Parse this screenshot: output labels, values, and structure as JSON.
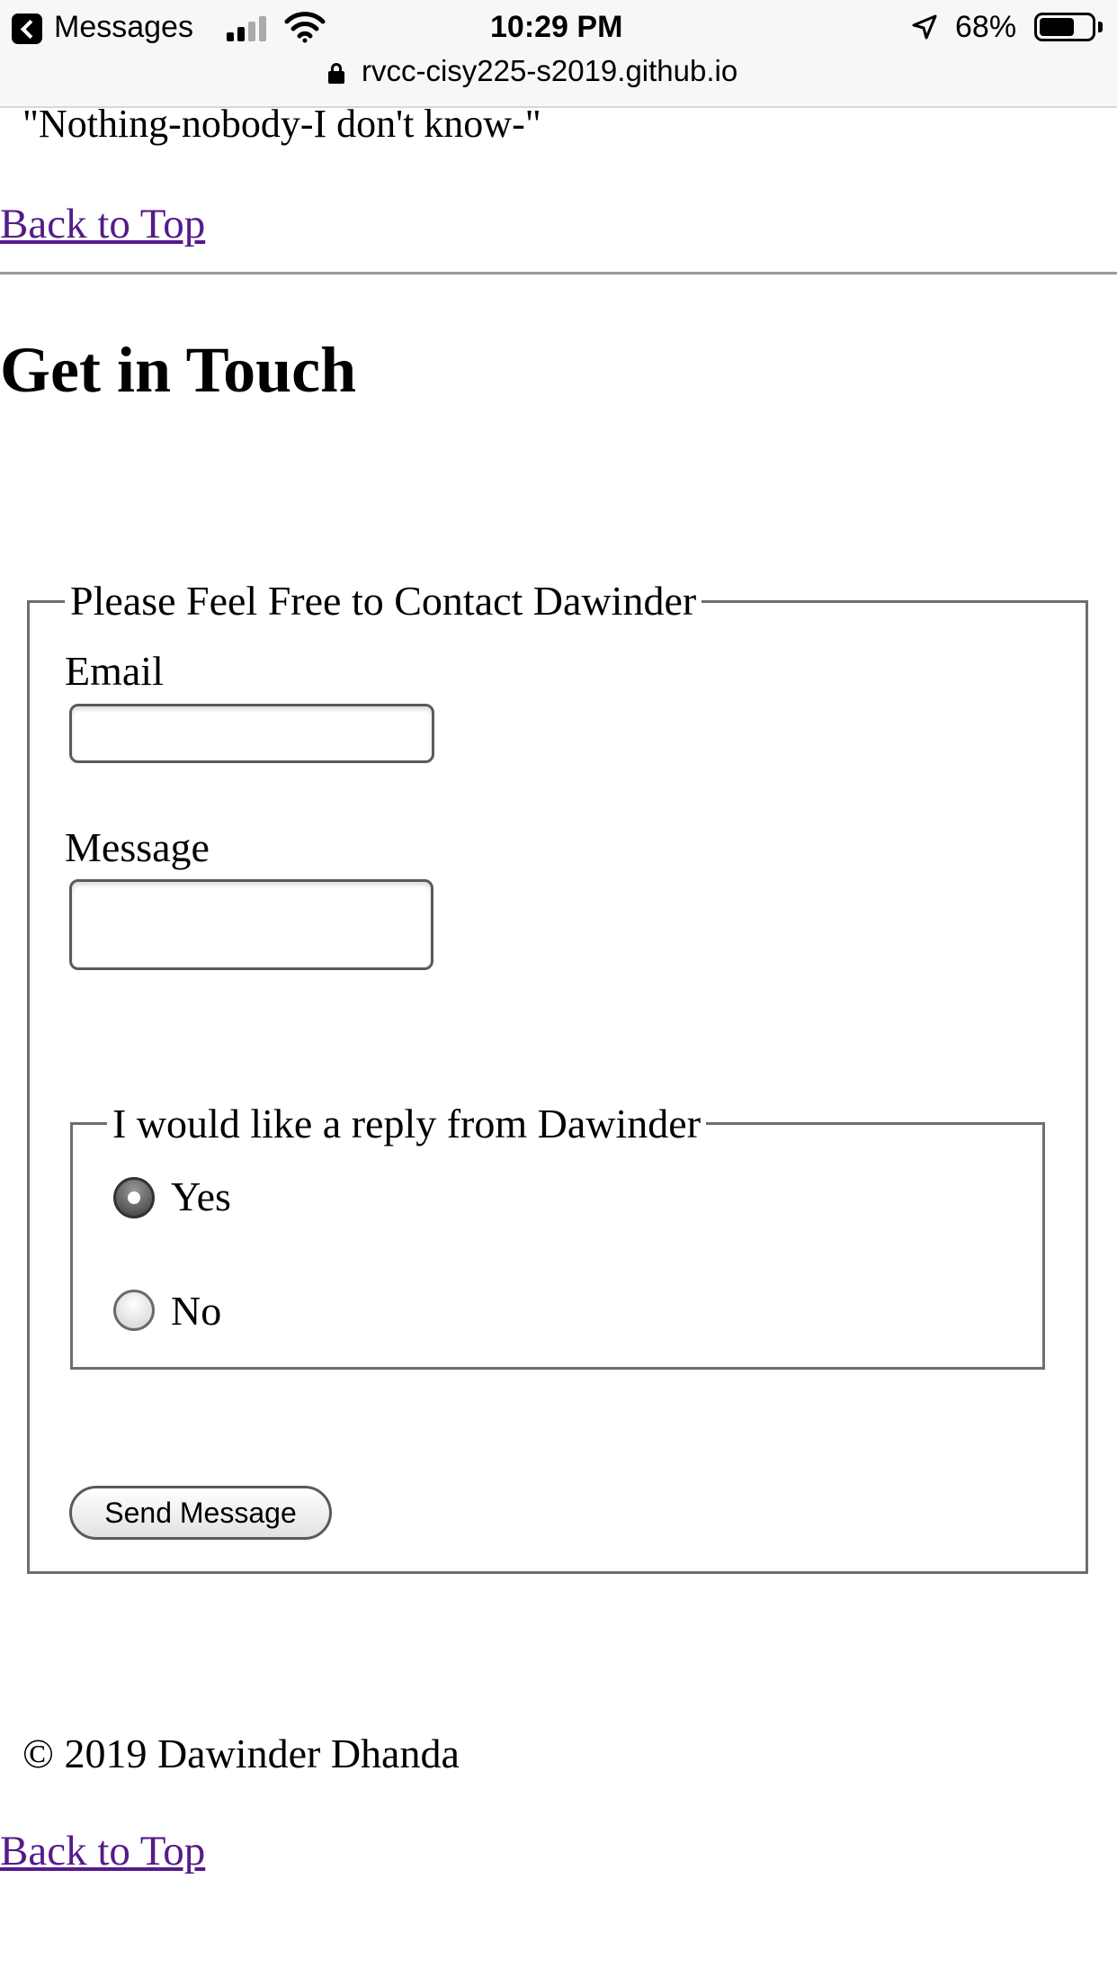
{
  "status_bar": {
    "back_app": "Messages",
    "time": "10:29 PM",
    "battery": "68%",
    "battery_level": 0.68,
    "url": "rvcc-cisy225-s2019.github.io",
    "icons": [
      "back-icon",
      "signal-icon",
      "wifi-icon",
      "location-arrow-icon",
      "battery-icon",
      "lock-icon"
    ]
  },
  "page": {
    "quote": "\"Nothing-nobody-I don't know-\"",
    "back_to_top": "Back to Top",
    "contact_heading": "Get in Touch",
    "form": {
      "legend": "Please Feel Free to Contact Dawinder",
      "email_label": "Email",
      "email_value": "",
      "message_label": "Message",
      "message_value": "",
      "reply_legend": "I would like a reply from Dawinder",
      "options": [
        {
          "label": "Yes",
          "checked": true
        },
        {
          "label": "No",
          "checked": false
        }
      ],
      "submit_label": "Send Message"
    },
    "footer": "© 2019 Dawinder Dhanda",
    "footer_link": "Back to Top"
  },
  "colors": {
    "link": "#551a8b",
    "border": "#6e6e6e",
    "status_bar_bg": "#f7f7f7"
  }
}
